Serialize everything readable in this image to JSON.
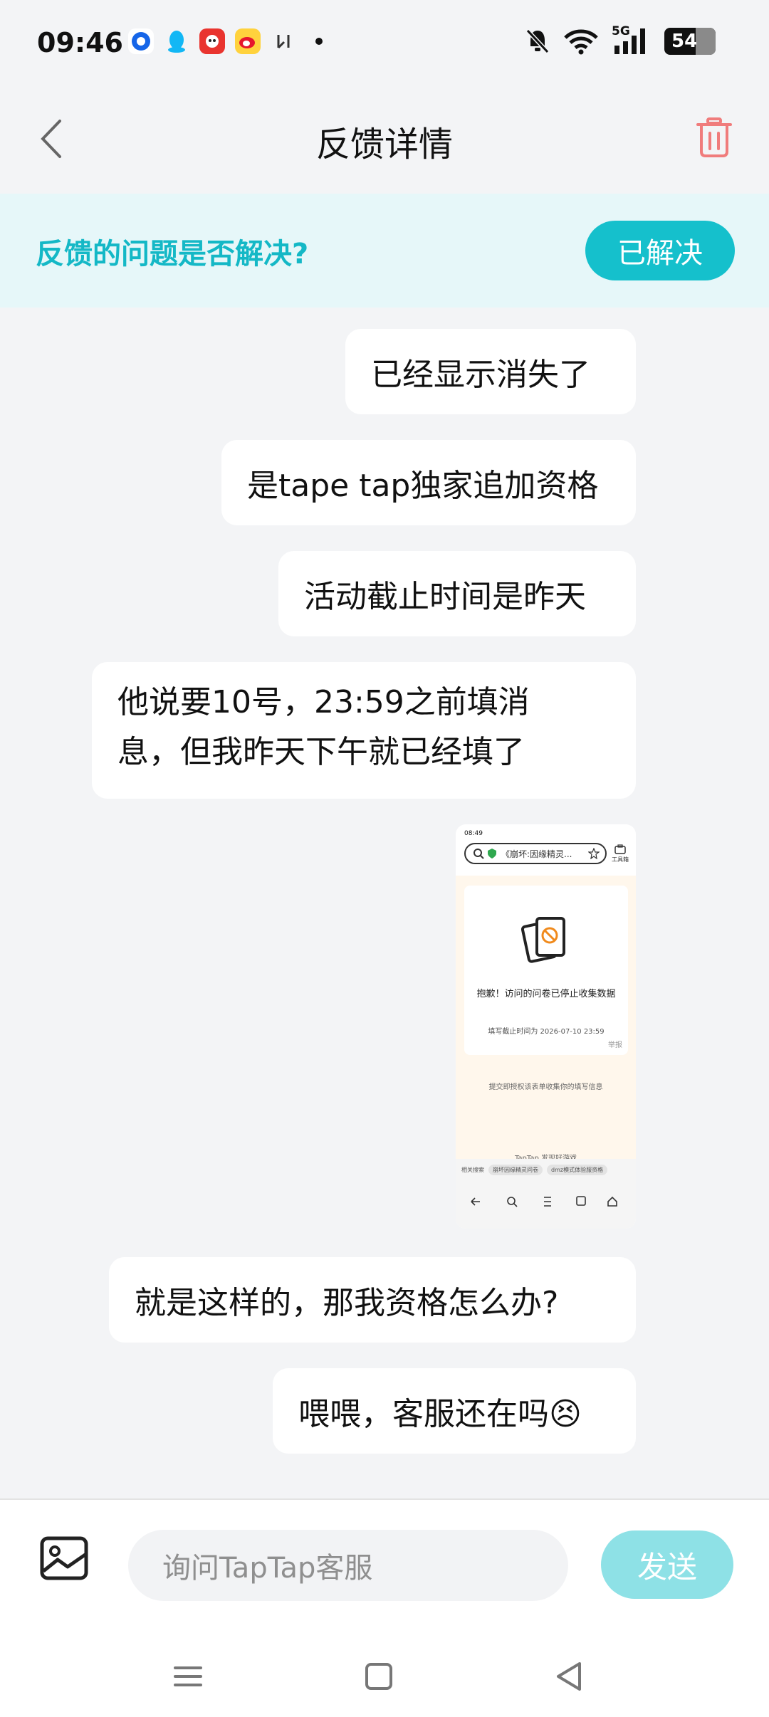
{
  "status_bar": {
    "time": "09:46",
    "network": "5G",
    "battery": "54"
  },
  "header": {
    "title": "反馈详情"
  },
  "resolve": {
    "question": "反馈的问题是否解决?",
    "button_label": "已解决"
  },
  "messages": [
    {
      "text": "已经显示消失了"
    },
    {
      "text": "是tape tap独家追加资格"
    },
    {
      "text": "活动截止时间是昨天"
    },
    {
      "text": "他说要10号，23:59之前填消息，但我昨天下午就已经填了"
    },
    {
      "text": "就是这样的，那我资格怎么办?"
    },
    {
      "text": "喂喂，客服还在吗😣"
    }
  ],
  "screenshot_attachment": {
    "status_time": "08:49",
    "url_text": "《崩坏:因缘精灵...",
    "toolbox_label": "工具箱",
    "message": "抱歉！访问的问卷已停止收集数据",
    "deadline": "填写截止时间为 2026-07-10 23:59",
    "report": "举报",
    "consent": "提交即授权该表单收集你的填写信息",
    "footer": "TapTap 发现好游戏",
    "related_label": "相关搜索",
    "related_chip_1": "崩坏因缘精灵问卷",
    "related_chip_2": "dmz模式体验服资格"
  },
  "input": {
    "placeholder": "询问TapTap客服",
    "send_label": "发送"
  },
  "colors": {
    "accent": "#15c0cc",
    "resolve_text": "#14b8c6",
    "send_disabled": "#8ee1e6",
    "trash": "#f07c7c"
  }
}
